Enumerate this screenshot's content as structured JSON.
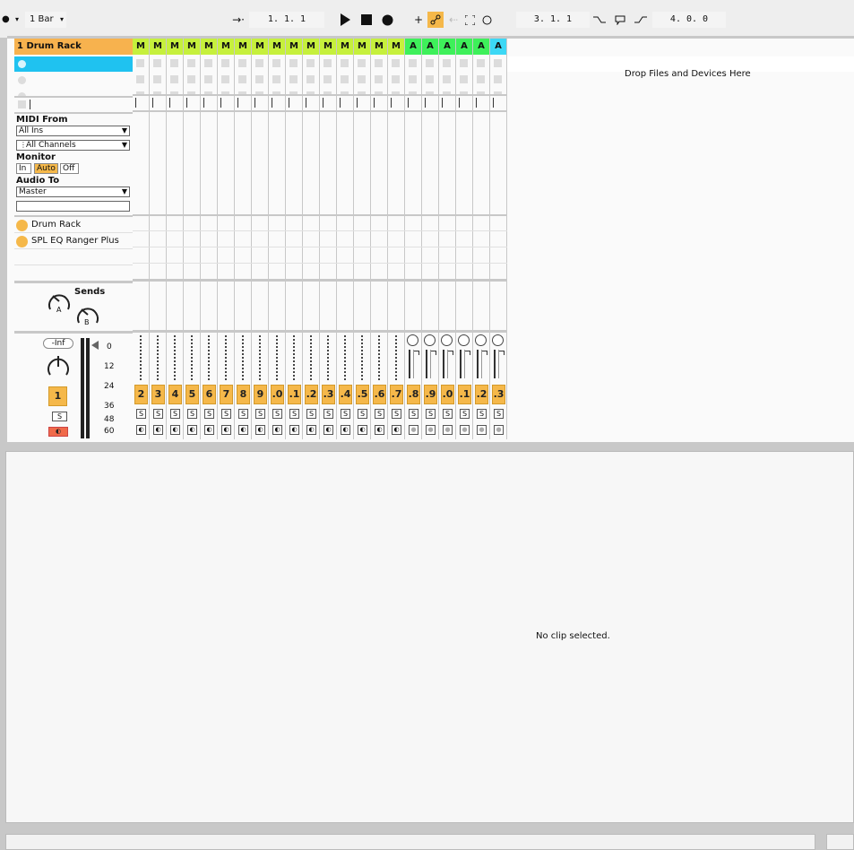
{
  "topbar": {
    "follow_dot": "●",
    "quantize": "1 Bar",
    "arrangement_position": "1.  1.  1",
    "loop_start": "3.  1.  1",
    "loop_length": "4.  0.  0"
  },
  "track": {
    "name": "1 Drum Rack",
    "midi_from_label": "MIDI From",
    "midi_from_value": "All Ins",
    "channel_value": "All Channels",
    "monitor_label": "Monitor",
    "monitor_in": "In",
    "monitor_auto": "Auto",
    "monitor_off": "Off",
    "audio_to_label": "Audio To",
    "audio_to_value": "Master",
    "devices": [
      "Drum Rack",
      "SPL EQ Ranger Plus"
    ],
    "sends_label": "Sends",
    "send_a": "A",
    "send_b": "B",
    "volume_value": "-Inf",
    "track_number": "1",
    "solo_label": "S",
    "meter_scale": [
      "0",
      "12",
      "24",
      "36",
      "48",
      "60"
    ]
  },
  "chains": {
    "header_letters": [
      "M",
      "M",
      "M",
      "M",
      "M",
      "M",
      "M",
      "M",
      "M",
      "M",
      "M",
      "M",
      "M",
      "M",
      "M",
      "M",
      "A",
      "A",
      "A",
      "A",
      "A",
      "A"
    ],
    "numbers": [
      "2",
      "3",
      "4",
      "5",
      "6",
      "7",
      "8",
      "9",
      ".0",
      ".1",
      ".2",
      ".3",
      ".4",
      ".5",
      ".6",
      ".7",
      ".8",
      ".9",
      ".0",
      ".1",
      ".2",
      ".3"
    ],
    "solo_label": "S",
    "colors": {
      "midi_header": "#c6f03c",
      "audio_header": "#3ef05a",
      "return_header": "#3cd8f5",
      "track_header": "#f7b24e",
      "selected_clip": "#1fc2f0",
      "number_button": "#f5b84a"
    }
  },
  "drop_area": "Drop Files and Devices Here",
  "detail": {
    "empty_message": "No clip selected."
  }
}
